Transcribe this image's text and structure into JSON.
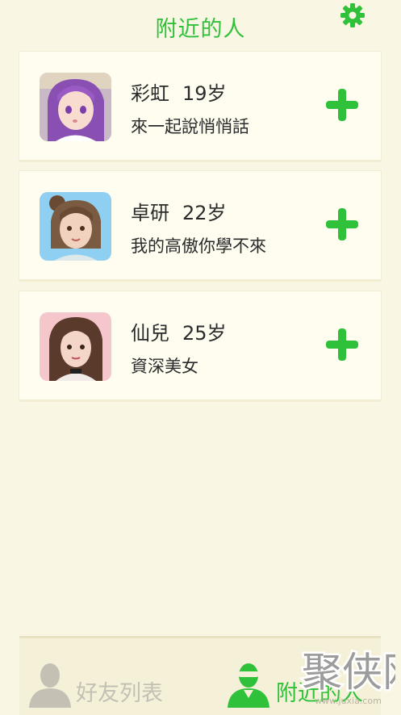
{
  "header": {
    "title": "附近的人"
  },
  "colors": {
    "accent": "#2fc13a",
    "background": "#f9f6e3",
    "card": "#fefdf0",
    "inactive": "#c4c0b4"
  },
  "people": [
    {
      "name": "彩虹",
      "age": "19岁",
      "signature": "來一起說悄悄話",
      "add_icon": "plus-icon"
    },
    {
      "name": "卓研",
      "age": "22岁",
      "signature": "我的高傲你學不來",
      "add_icon": "plus-icon"
    },
    {
      "name": "仙兒",
      "age": "25岁",
      "signature": "資深美女",
      "add_icon": "plus-icon"
    }
  ],
  "tabs": [
    {
      "label": "好友列表",
      "icon": "person-icon",
      "active": false
    },
    {
      "label": "附近的人",
      "icon": "ninja-person-icon",
      "active": true
    }
  ],
  "watermark": {
    "text": "聚侠网",
    "url": "www.juxia.com"
  }
}
